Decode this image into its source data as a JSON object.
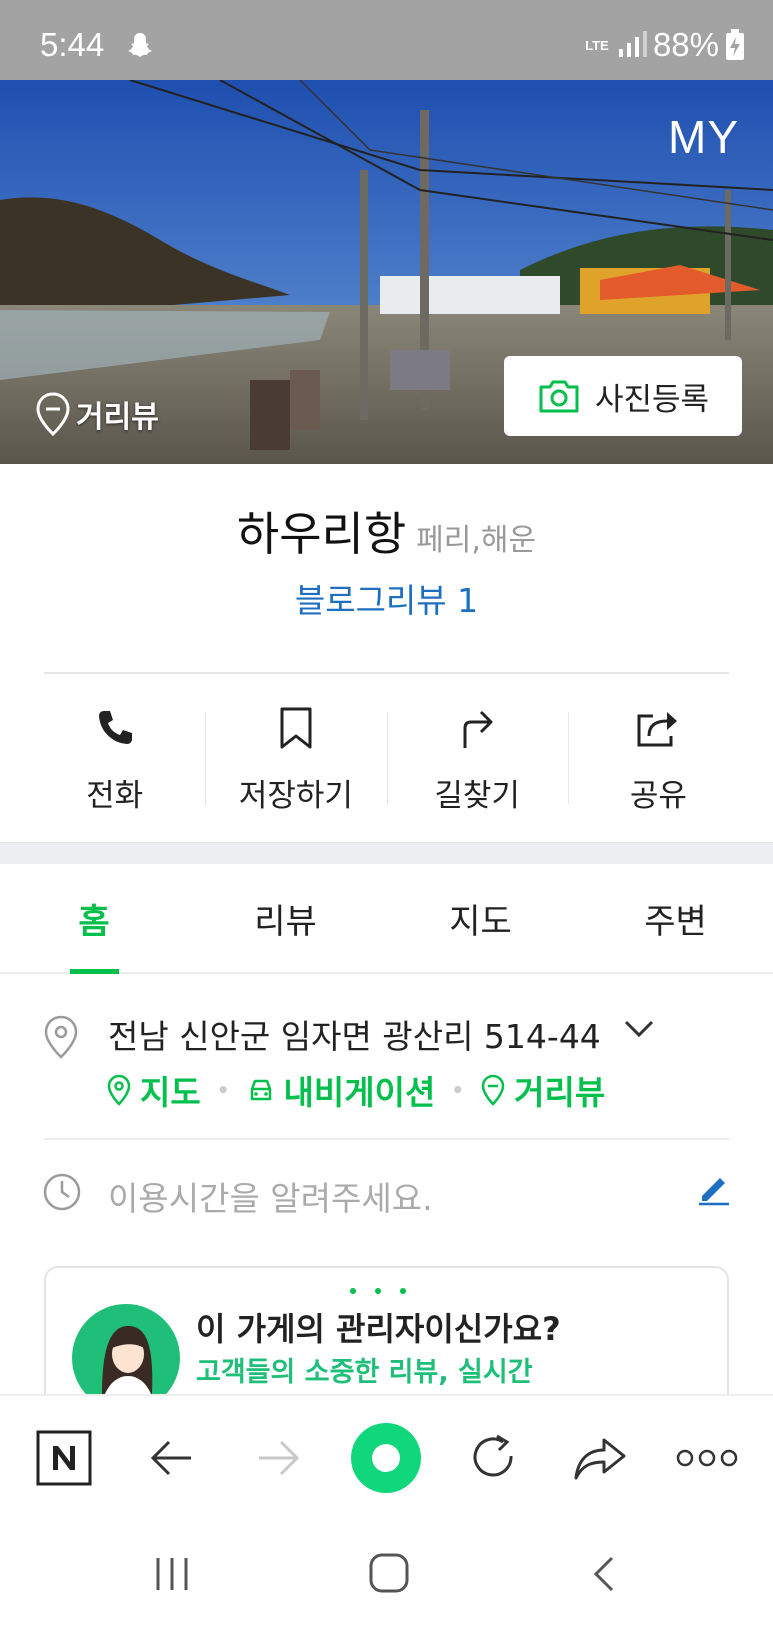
{
  "status_bar": {
    "time": "5:44",
    "network": "LTE",
    "battery": "88%"
  },
  "hero": {
    "my_label": "MY",
    "street_view_label": "거리뷰",
    "photo_register_label": "사진등록"
  },
  "place": {
    "name": "하우리항",
    "category": "페리,해운",
    "blog_review": "블로그리뷰 1"
  },
  "actions": [
    {
      "icon": "phone-icon",
      "label": "전화"
    },
    {
      "icon": "bookmark-icon",
      "label": "저장하기"
    },
    {
      "icon": "directions-icon",
      "label": "길찾기"
    },
    {
      "icon": "share-icon",
      "label": "공유"
    }
  ],
  "tabs": [
    {
      "label": "홈",
      "active": true
    },
    {
      "label": "리뷰",
      "active": false
    },
    {
      "label": "지도",
      "active": false
    },
    {
      "label": "주변",
      "active": false
    }
  ],
  "address": {
    "text": "전남 신안군 임자면 광산리 514-44",
    "links": [
      "지도",
      "내비게이션",
      "거리뷰"
    ]
  },
  "hours": {
    "placeholder": "이용시간을 알려주세요."
  },
  "owner_card": {
    "question": "이 가게의 관리자이신가요?",
    "subtitle": "고객들의 소중한 리뷰, 실시간"
  },
  "colors": {
    "accent_green": "#03bf4b",
    "link_blue": "#1f6fc0",
    "status_bar_bg": "#a3a3a3"
  }
}
